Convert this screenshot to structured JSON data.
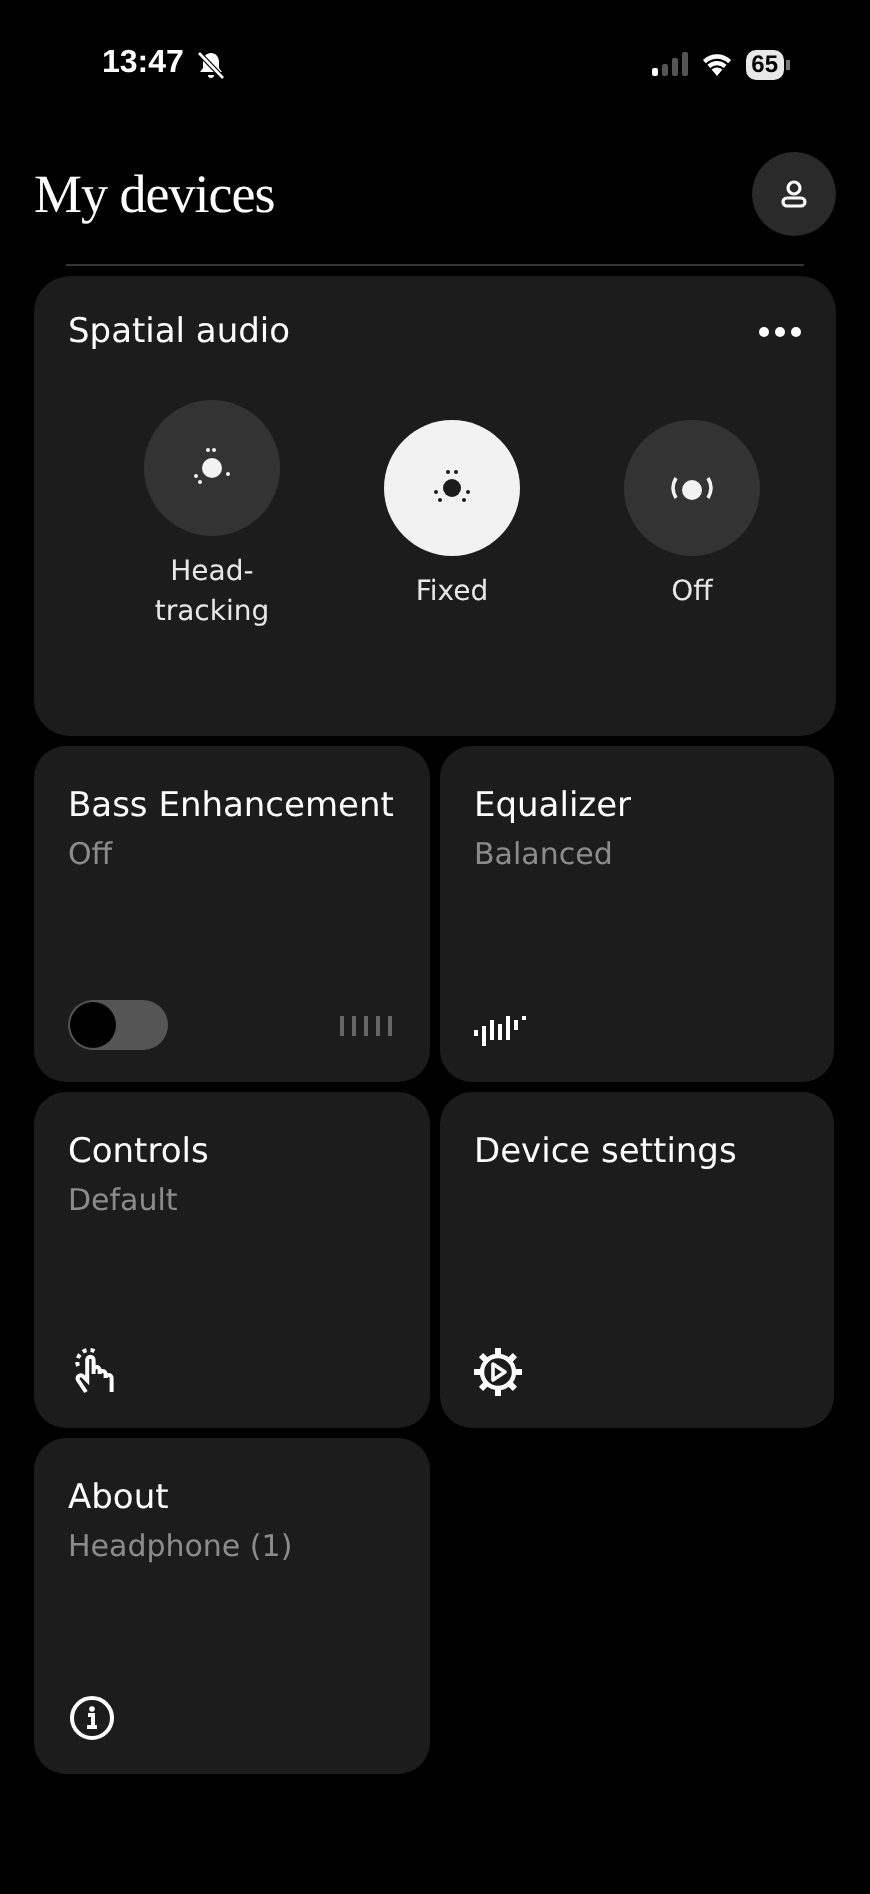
{
  "status_bar": {
    "time": "13:47",
    "silent": true,
    "battery": "65"
  },
  "header": {
    "title": "My devices"
  },
  "spatial_audio": {
    "title": "Spatial audio",
    "modes": [
      {
        "kind": "head-tracking",
        "label": "Head-\ntracking",
        "selected": false
      },
      {
        "kind": "fixed",
        "label": "Fixed",
        "selected": true
      },
      {
        "kind": "off",
        "label": "Off",
        "selected": false
      }
    ]
  },
  "tiles": [
    {
      "kind": "bass",
      "title": "Bass Enhancement",
      "subtitle": "Off",
      "on": false
    },
    {
      "kind": "equalizer",
      "title": "Equalizer",
      "subtitle": "Balanced"
    },
    {
      "kind": "controls",
      "title": "Controls",
      "subtitle": "Default"
    },
    {
      "kind": "settings",
      "title": "Device settings"
    },
    {
      "kind": "about",
      "title": "About",
      "subtitle": "Headphone (1)"
    }
  ]
}
